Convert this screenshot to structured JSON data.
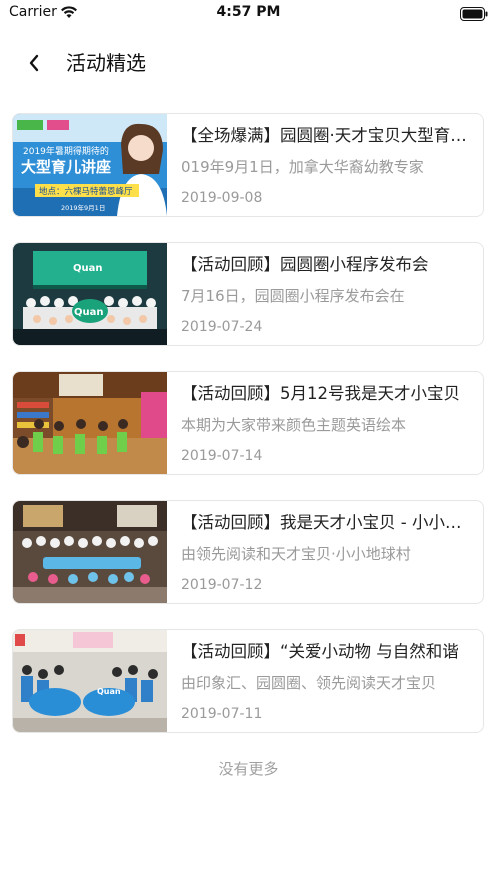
{
  "status_bar": {
    "carrier": "Carrier",
    "time": "4:57 PM"
  },
  "nav": {
    "back_icon": "chevron-left-icon",
    "title": "活动精选"
  },
  "articles": [
    {
      "title": "【全场爆满】园圆圈·天才宝贝大型育儿讲座",
      "desc": "019年9月1日，加拿大华裔幼教专家",
      "date": "2019-09-08",
      "thumb_text_1": "2019年暑期得期待的",
      "thumb_text_2": "大型育儿讲座",
      "thumb_text_3": "地点：六棵马特蕾恩峰厅",
      "thumb_text_4": "2019年9月1日"
    },
    {
      "title": "【活动回顾】园圆圈小程序发布会",
      "desc": "7月16日，园圆圈小程序发布会在",
      "date": "2019-07-24",
      "thumb_text_1": "Quan"
    },
    {
      "title": "【活动回顾】5月12号我是天才小宝贝",
      "desc": "本期为大家带来颜色主题英语绘本",
      "date": "2019-07-14"
    },
    {
      "title": "【活动回顾】我是天才小宝贝 - 小小地球",
      "desc": "由领先阅读和天才宝贝·小小地球村",
      "date": "2019-07-12"
    },
    {
      "title": "【活动回顾】“关爱小动物 与自然和谐",
      "desc": "由印象汇、园圆圈、领先阅读天才宝贝",
      "date": "2019-07-11",
      "thumb_text_1": "Quan"
    }
  ],
  "footer": {
    "text": "没有更多"
  },
  "colors": {
    "card_border": "#e6e6e6",
    "muted_text": "#9a9a9a",
    "title_text": "#222222"
  }
}
